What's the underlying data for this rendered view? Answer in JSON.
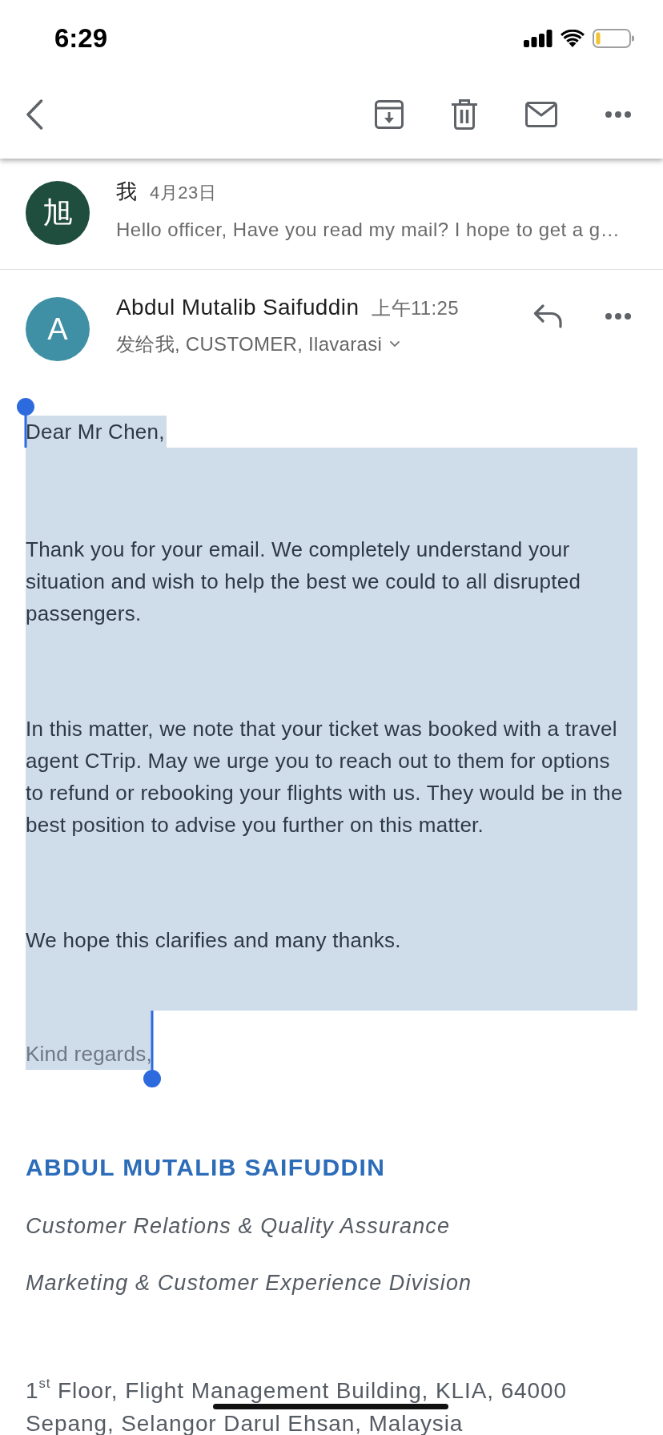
{
  "status_bar": {
    "time": "6:29"
  },
  "thread": [
    {
      "avatar": {
        "letter": "旭",
        "color": "#1f4d3e"
      },
      "sender": "我",
      "date": "4月23日",
      "snippet": "Hello officer, Have you read my mail? I hope to get a g…"
    }
  ],
  "message": {
    "avatar": {
      "letter": "A",
      "color": "#3f8fa5"
    },
    "sender": "Abdul Mutalib Saifuddin",
    "time": "上午11:25",
    "recipients": "发给我, CUSTOMER, Ilavarasi",
    "recipients_expanded": false
  },
  "body": {
    "selected": true,
    "greeting": "Dear Mr Chen,",
    "paragraphs": [
      "Thank you for your email. We completely understand your situation and wish to help the best we could to all disrupted passengers.",
      "In this matter, we note that your ticket was booked with a travel agent CTrip. May we urge you to reach out to them for options to refund or rebooking your flights with us. They would be in the best position to advise you further on this matter.",
      "We hope this clarifies and many thanks."
    ],
    "closing": "Kind regards,"
  },
  "signature": {
    "name": "ABDUL MUTALIB SAIFUDDIN",
    "titles": [
      "Customer Relations & Quality Assurance",
      "Marketing & Customer Experience Division"
    ],
    "address": [
      "1$^{st}$ Floor, Flight Management Building, KLIA, 64000",
      "Sepang, Selangor Darul Ehsan, Malaysia"
    ]
  }
}
